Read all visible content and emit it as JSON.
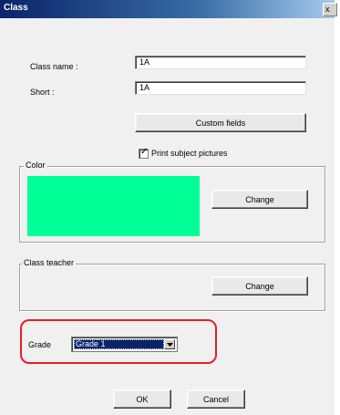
{
  "window": {
    "title": "Class",
    "close_glyph": "x"
  },
  "form": {
    "class_name_label": "Class name :",
    "class_name_value": "1A",
    "short_label": "Short :",
    "short_value": "1A",
    "custom_fields_button": "Custom fields",
    "print_pictures_label": "Print subject pictures",
    "print_pictures_checked": true
  },
  "color_group": {
    "title": "Color",
    "swatch_color": "#00ff96",
    "change_button": "Change"
  },
  "teacher_group": {
    "title": "Class teacher",
    "change_button": "Change"
  },
  "grade": {
    "label": "Grade",
    "selected": "Grade 1",
    "highlight_color": "#e0202a"
  },
  "footer": {
    "ok_button": "OK",
    "cancel_button": "Cancel"
  },
  "icons": {
    "checkmark": "check-icon",
    "dropdown": "chevron-down-icon"
  }
}
